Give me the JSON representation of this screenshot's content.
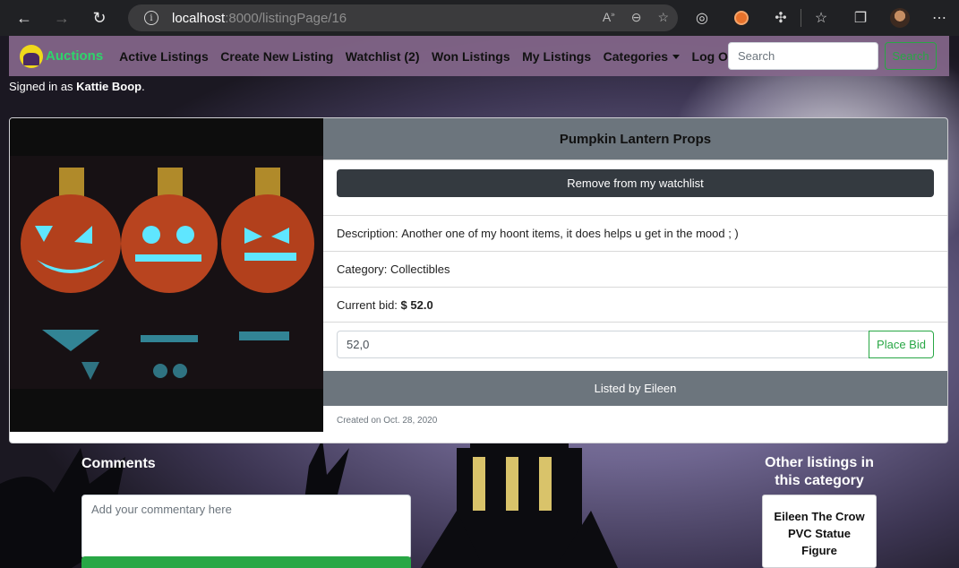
{
  "browser": {
    "url_host": "localhost",
    "url_rest": ":8000/listingPage/16",
    "back_icon": "←",
    "forward_icon": "→",
    "reload_icon": "↻",
    "more_icon": "⋯"
  },
  "navbar": {
    "brand": "Auctions",
    "links": [
      "Active Listings",
      "Create New Listing",
      "Watchlist (2)",
      "Won Listings",
      "My Listings",
      "Categories",
      "Log Out"
    ],
    "search_placeholder": "Search",
    "search_button": "Search",
    "colors": {
      "brand": "#2ed66b",
      "bar": "#84678b"
    }
  },
  "user": {
    "signed_prefix": "Signed in as ",
    "name": "Kattie Boop",
    "suffix": "."
  },
  "listing": {
    "title": "Pumpkin Lantern Props",
    "watchlist_button": "Remove from my watchlist",
    "description_label": "Description: ",
    "description": "Another one of my hoont items, it does helps u get in the mood ; )",
    "category_label": "Category: ",
    "category": "Collectibles",
    "bid_label": "Current bid: ",
    "bid": "$ 52.0",
    "bid_input_value": "52,0",
    "place_bid": "Place Bid",
    "listed_by": "Listed by Eileen",
    "created": "Created on Oct. 28, 2020"
  },
  "comments": {
    "title": "Comments",
    "placeholder": "Add your commentary here"
  },
  "other": {
    "title": "Other listings in this category",
    "items": [
      "Eileen The Crow PVC Statue Figure"
    ]
  }
}
